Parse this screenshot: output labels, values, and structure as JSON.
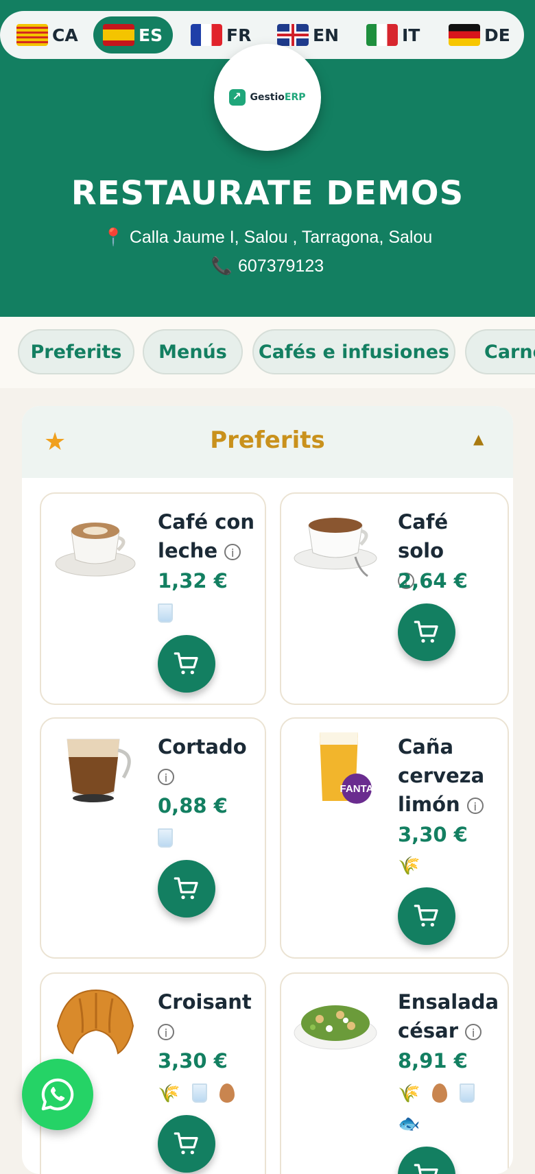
{
  "languages": [
    {
      "code": "CA",
      "flag": "catalonia-flag-icon",
      "active": false
    },
    {
      "code": "ES",
      "flag": "spain-flag-icon",
      "active": true
    },
    {
      "code": "FR",
      "flag": "france-flag-icon",
      "active": false
    },
    {
      "code": "EN",
      "flag": "uk-flag-icon",
      "active": false
    },
    {
      "code": "IT",
      "flag": "italy-flag-icon",
      "active": false
    },
    {
      "code": "DE",
      "flag": "germany-flag-icon",
      "active": false
    }
  ],
  "logo": {
    "text_main": "Gestio",
    "text_accent": "ERP"
  },
  "restaurant": {
    "name": "RESTAURATE DEMOS",
    "address": "Calla Jaume I, Salou , Tarragona, Salou",
    "phone": "607379123"
  },
  "categories": [
    {
      "label": "Preferits"
    },
    {
      "label": "Menús"
    },
    {
      "label": "Cafés e infusiones"
    },
    {
      "label": "Carnes"
    }
  ],
  "section": {
    "title": "Preferits",
    "star": "★",
    "caret": "▲"
  },
  "products": [
    {
      "name": "Café con leche",
      "price": "1,32 €",
      "allergens": [
        "milk"
      ]
    },
    {
      "name": "Café solo",
      "price": "2,64 €",
      "allergens": []
    },
    {
      "name": "Cortado",
      "price": "0,88 €",
      "allergens": [
        "milk"
      ]
    },
    {
      "name": "Caña cerveza limón",
      "price": "3,30 €",
      "allergens": [
        "gluten"
      ]
    },
    {
      "name": "Croisant",
      "price": "3,30 €",
      "allergens": [
        "gluten",
        "milk",
        "egg"
      ]
    },
    {
      "name": "Ensalada césar",
      "price": "8,91 €",
      "allergens": [
        "gluten",
        "egg",
        "milk",
        "fish"
      ]
    }
  ],
  "colors": {
    "primary": "#137f61",
    "accent_gold": "#c9911c",
    "whatsapp": "#25d366"
  }
}
